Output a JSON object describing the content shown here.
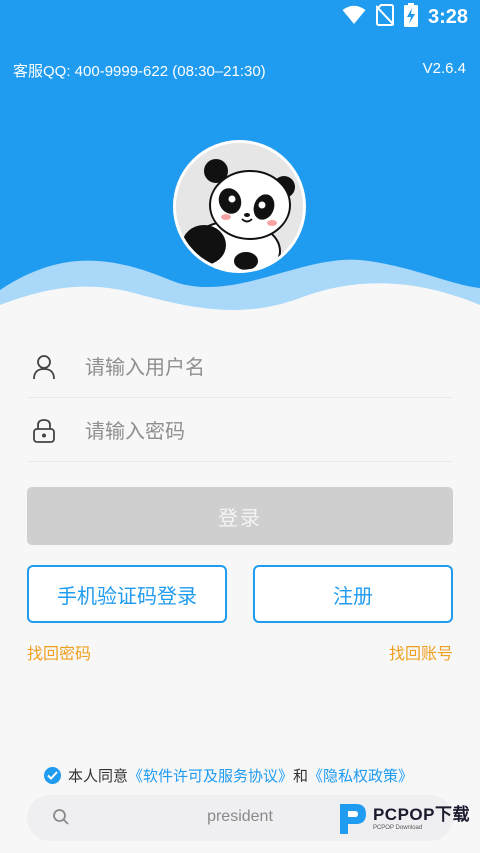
{
  "status_bar": {
    "time": "3:28"
  },
  "header": {
    "service_line": "客服QQ: 400-9999-622 (08:30–21:30)",
    "version": "V2.6.4"
  },
  "form": {
    "username_placeholder": "请输入用户名",
    "password_placeholder": "请输入密码",
    "login_label": "登录",
    "sms_login_label": "手机验证码登录",
    "register_label": "注册",
    "forgot_password": "找回密码",
    "forgot_account": "找回账号"
  },
  "agreement": {
    "prefix": "本人同意",
    "terms_link": "《软件许可及服务协议》",
    "joiner": "和",
    "privacy_link": "《隐私权政策》"
  },
  "bottom_bar": {
    "text": "president"
  },
  "watermark": {
    "brand": "PCPOP下载",
    "sub": "PCPOP Download"
  },
  "colors": {
    "accent": "#1f9bf0",
    "link_orange": "#f0a020",
    "disabled_button": "#cfcfcf"
  },
  "icons": [
    "wifi-icon",
    "no-sim-icon",
    "battery-charging-icon",
    "user-icon",
    "lock-icon",
    "check-icon",
    "search-icon"
  ]
}
